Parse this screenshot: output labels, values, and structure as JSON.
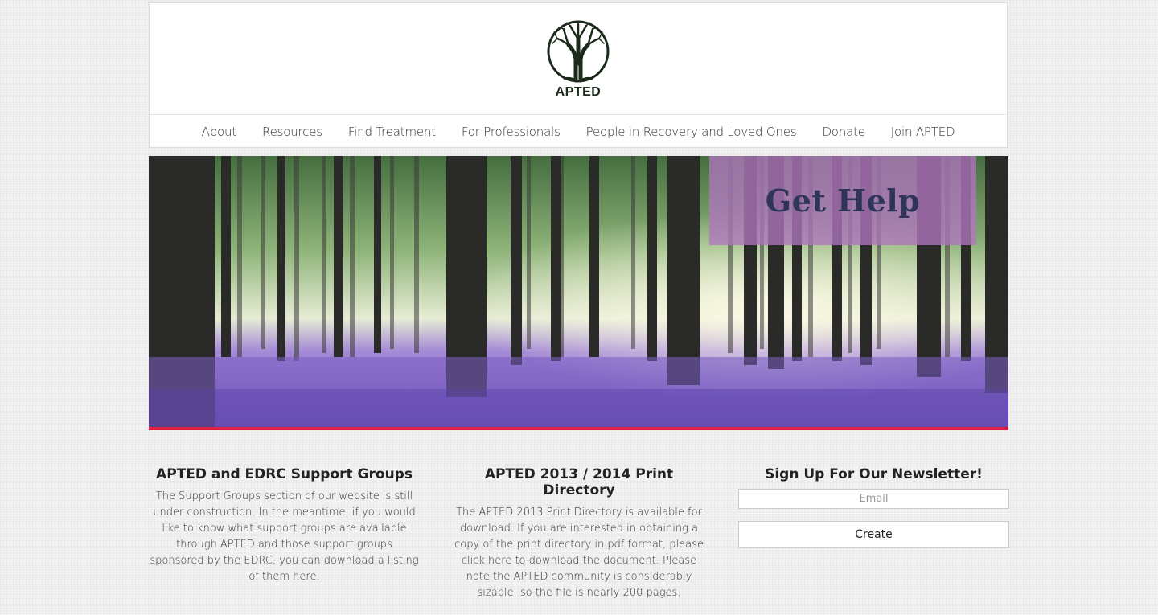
{
  "header": {
    "logo_text": "APTED"
  },
  "nav": {
    "items": [
      {
        "label": "About"
      },
      {
        "label": "Resources"
      },
      {
        "label": "Find Treatment"
      },
      {
        "label": "For Professionals"
      },
      {
        "label": "People in Recovery and Loved Ones"
      },
      {
        "label": "Donate"
      },
      {
        "label": "Join APTED"
      }
    ]
  },
  "hero": {
    "overlay_text": "Get Help",
    "accent_color": "#e11d3b"
  },
  "columns": {
    "support": {
      "title": "APTED and EDRC Support Groups",
      "body": "The Support Groups section of our website is still under construction. In the meantime, if you would like to know what support groups are available through APTED and those support groups sponsored by the EDRC, you can download a listing of them here."
    },
    "directory": {
      "title": "APTED 2013 / 2014 Print Directory",
      "body": "The APTED 2013 Print Directory is available for download. If you are interested in obtaining a copy of the print directory in pdf format, please click here to download the document. Please note the APTED community is considerably sizable, so the file is nearly 200 pages."
    },
    "newsletter": {
      "title": "Sign Up For Our Newsletter!",
      "email_placeholder": "Email",
      "email_value": "",
      "button_label": "Create"
    }
  }
}
